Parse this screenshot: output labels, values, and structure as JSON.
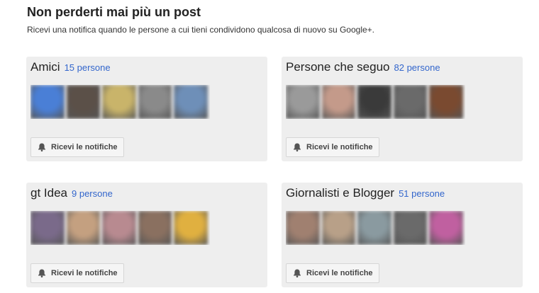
{
  "header": {
    "title": "Non perderti mai più un post",
    "subtitle": "Ricevi una notifica quando le persone a cui tieni condividono qualcosa di nuovo su Google+."
  },
  "circles": [
    {
      "title": "Amici",
      "count": "15 persone",
      "button": "Ricevi le notifiche",
      "avatar_colors": [
        "#4a7fd6",
        "#5b5048",
        "#c9b46a",
        "#8a8a8a",
        "#6e8fb8"
      ]
    },
    {
      "title": "Persone che seguo",
      "count": "82 persone",
      "button": "Ricevi le notifiche",
      "avatar_colors": [
        "#9a9a9a",
        "#c49a8a",
        "#3a3a3a",
        "#6a6a6a",
        "#7a4a30"
      ]
    },
    {
      "title": "gt Idea",
      "count": "9 persone",
      "button": "Ricevi le notifiche",
      "avatar_colors": [
        "#7a6a8a",
        "#c4a080",
        "#b88a90",
        "#8a7060",
        "#e0b040"
      ]
    },
    {
      "title": "Giornalisti e Blogger",
      "count": "51 persone",
      "button": "Ricevi le notifiche",
      "avatar_colors": [
        "#a08070",
        "#b8a088",
        "#8a9aa0",
        "#6a6a6a",
        "#c060a0"
      ]
    }
  ]
}
